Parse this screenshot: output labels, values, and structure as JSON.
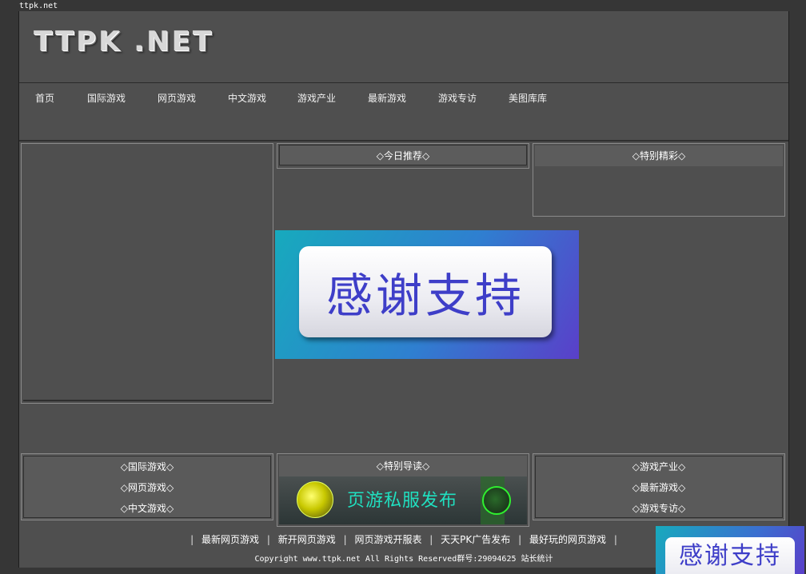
{
  "site_tag": "ttpk.net",
  "logo": "TTPK .NET",
  "nav": [
    "首页",
    "国际游戏",
    "网页游戏",
    "中文游戏",
    "游戏产业",
    "最新游戏",
    "游戏专访",
    "美图库库"
  ],
  "panels": {
    "today": "◇今日推荐◇",
    "special": "◇特别精彩◇",
    "guide": "◇特别导读◇"
  },
  "banner_text": "感谢支持",
  "bottom_left": [
    "◇国际游戏◇",
    "◇网页游戏◇",
    "◇中文游戏◇"
  ],
  "bottom_right": [
    "◇游戏产业◇",
    "◇最新游戏◇",
    "◇游戏专访◇"
  ],
  "ad_text": "页游私服发布",
  "footer_links": [
    "最新网页游戏",
    "新开网页游戏",
    "网页游戏开服表",
    "天天PK广告发布",
    "最好玩的网页游戏"
  ],
  "footer_sep": "|",
  "copyright": "Copyright www.ttpk.net All Rights Reserved群号:29094625 站长统计",
  "float_ad_text": "感谢支持"
}
